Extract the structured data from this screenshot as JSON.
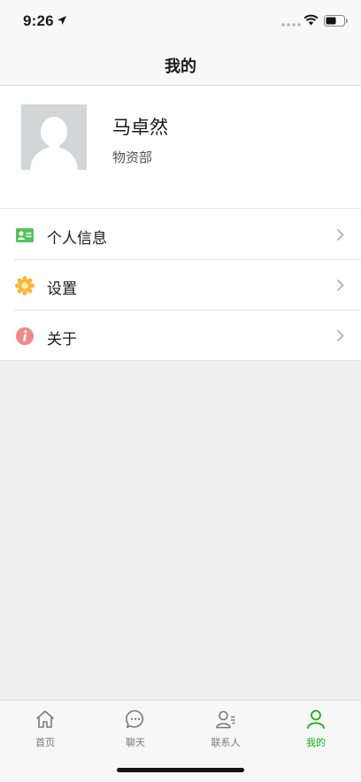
{
  "status_bar": {
    "time": "9:26"
  },
  "nav": {
    "title": "我的"
  },
  "profile": {
    "name": "马卓然",
    "department": "物资部"
  },
  "menu": [
    {
      "label": "个人信息",
      "icon": "id-card-icon",
      "color": "#56c25c"
    },
    {
      "label": "设置",
      "icon": "gear-icon",
      "color": "#f5b83d"
    },
    {
      "label": "关于",
      "icon": "info-icon",
      "color": "#f08a8a"
    }
  ],
  "tabs": [
    {
      "label": "首页",
      "icon": "home-icon",
      "active": false
    },
    {
      "label": "聊天",
      "icon": "chat-icon",
      "active": false
    },
    {
      "label": "联系人",
      "icon": "contacts-icon",
      "active": false
    },
    {
      "label": "我的",
      "icon": "person-icon",
      "active": true
    }
  ],
  "colors": {
    "accent": "#1aad19",
    "inactive": "#7a7a7a",
    "background": "#efefef"
  }
}
